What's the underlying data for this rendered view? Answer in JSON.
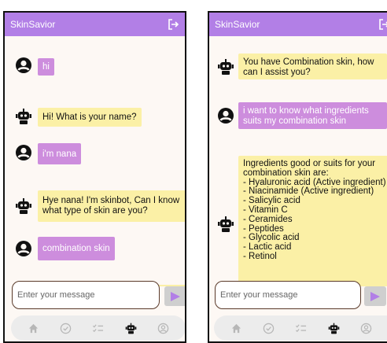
{
  "app": {
    "title": "SkinSavior"
  },
  "left_screen": {
    "messages": [
      {
        "sender": "user",
        "text": "hi"
      },
      {
        "sender": "bot",
        "text": "Hi! What is your name?"
      },
      {
        "sender": "user",
        "text": "i'm nana"
      },
      {
        "sender": "bot",
        "text": "Hye nana! I'm skinbot, Can I know what type of skin are you?"
      },
      {
        "sender": "user",
        "text": "combination skin"
      }
    ]
  },
  "right_screen": {
    "messages": [
      {
        "sender": "bot",
        "text": "You have Combination skin, how can I assist you?"
      },
      {
        "sender": "user",
        "text": "i want to know what ingredients suits my combination skin"
      },
      {
        "sender": "bot",
        "text": "Ingredients good or suits for your combination skin are:\n- Hyaluronic acid (Active ingredient)\n- Niacinamide (Active ingredient)\n- Salicylic acid\n- Vitamin C\n- Ceramides\n- Peptides\n- Glycolic acid\n- Lactic acid\n- Retinol"
      }
    ]
  },
  "input": {
    "placeholder": "Enter your message"
  },
  "nav": {
    "items": [
      "home-icon",
      "check-circle-icon",
      "checklist-icon",
      "robot-icon",
      "profile-icon"
    ],
    "active": "robot-icon"
  },
  "colors": {
    "appbar": "#b27fe6",
    "user_bubble": "#cd8ddd",
    "bot_bubble": "#fbf0a6",
    "send_arrow": "#b27fe6"
  }
}
